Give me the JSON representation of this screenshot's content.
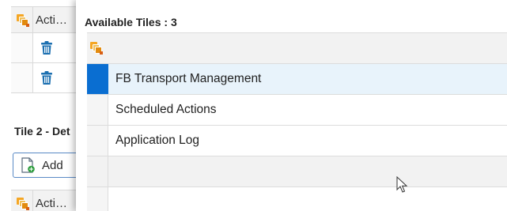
{
  "background_panel": {
    "table1": {
      "header_label": "Acti…",
      "rows": [
        {
          "icon": "trash-icon"
        },
        {
          "icon": "trash-icon"
        }
      ]
    },
    "section_title": "Tile 2 - Det",
    "add_button_label": "Add",
    "table2": {
      "header_label": "Acti…"
    }
  },
  "popup": {
    "title": "Available Tiles : 3",
    "list_header_icon": "select-all-icon",
    "items": [
      {
        "label": "FB Transport Management",
        "selected": true
      },
      {
        "label": "Scheduled Actions",
        "selected": false
      },
      {
        "label": "Application Log",
        "selected": false
      }
    ]
  },
  "colors": {
    "accent": "#0a6ed1",
    "selected_row": "#e8f3fb",
    "trash_icon": "#1b6fb0",
    "select_all_icon": "#f5a623"
  }
}
